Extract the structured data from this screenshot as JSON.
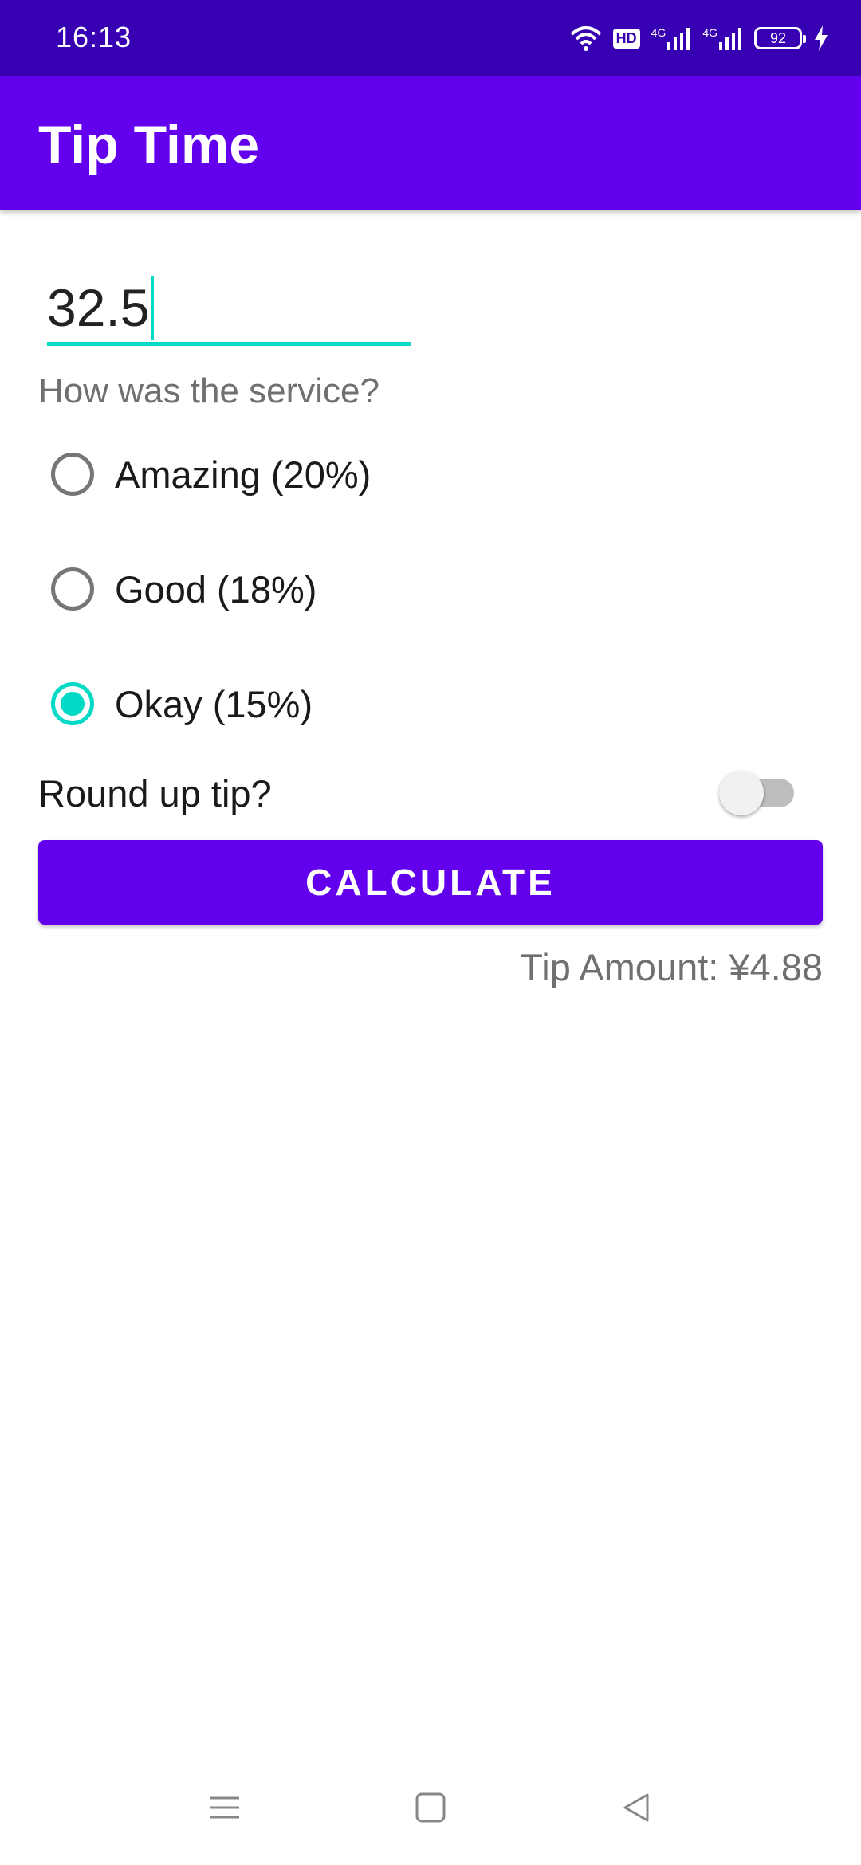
{
  "status_bar": {
    "time": "16:13",
    "hd_label": "HD",
    "signal_1_label": "4G",
    "signal_2_label": "4G",
    "battery_level": "92",
    "icons": [
      "wifi-icon",
      "hd-icon",
      "signal-4g-icon",
      "signal-4g-icon",
      "battery-icon",
      "charging-icon"
    ]
  },
  "app_bar": {
    "title": "Tip Time"
  },
  "form": {
    "cost_value": "32.5",
    "service_question": "How was the service?",
    "options": [
      {
        "label": "Amazing (20%)",
        "checked": false
      },
      {
        "label": "Good (18%)",
        "checked": false
      },
      {
        "label": "Okay (15%)",
        "checked": true
      }
    ],
    "round_up_label": "Round up tip?",
    "round_up_on": false,
    "calculate_label": "CALCULATE",
    "tip_amount": "Tip Amount: ¥4.88"
  },
  "colors": {
    "status_bar": "#3700B3",
    "primary": "#6200EE",
    "accent": "#03DAC5"
  },
  "nav_bar": {
    "icons": [
      "menu-icon",
      "home-icon",
      "back-icon"
    ]
  }
}
